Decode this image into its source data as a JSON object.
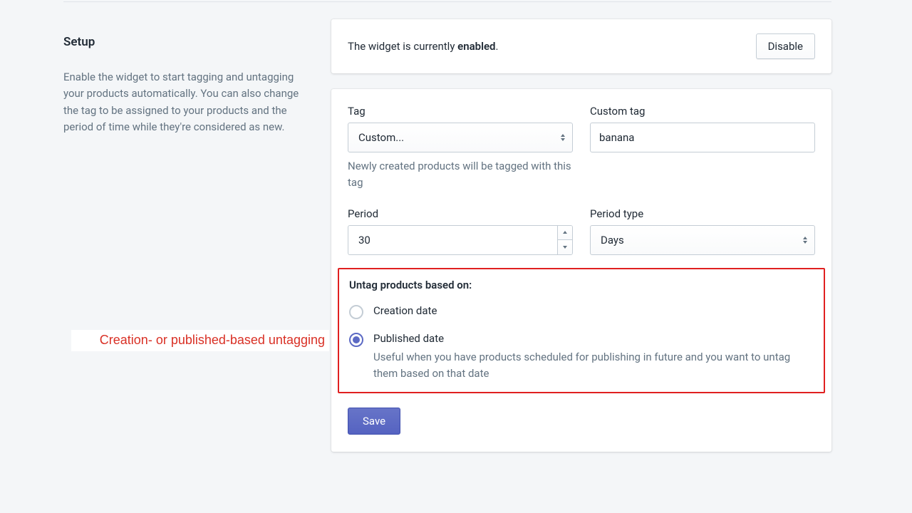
{
  "sidebar": {
    "heading": "Setup",
    "description": "Enable the widget to start tagging and untagging your products automatically. You can also change the tag to be assigned to your products and the period of time while they're considered as new."
  },
  "status": {
    "prefix": "The widget is currently ",
    "state": "enabled",
    "suffix": ".",
    "disable_label": "Disable"
  },
  "form": {
    "tag": {
      "label": "Tag",
      "value": "Custom...",
      "help": "Newly created products will be tagged with this tag"
    },
    "custom_tag": {
      "label": "Custom tag",
      "value": "banana"
    },
    "period": {
      "label": "Period",
      "value": "30"
    },
    "period_type": {
      "label": "Period type",
      "value": "Days"
    },
    "untag": {
      "heading": "Untag products based on:",
      "options": {
        "creation": {
          "label": "Creation date",
          "selected": false
        },
        "published": {
          "label": "Published date",
          "selected": true,
          "help": "Useful when you have products scheduled for publishing in future and you want to untag them based on that date"
        }
      }
    },
    "save_label": "Save"
  },
  "annotation": "Creation- or published-based untagging"
}
